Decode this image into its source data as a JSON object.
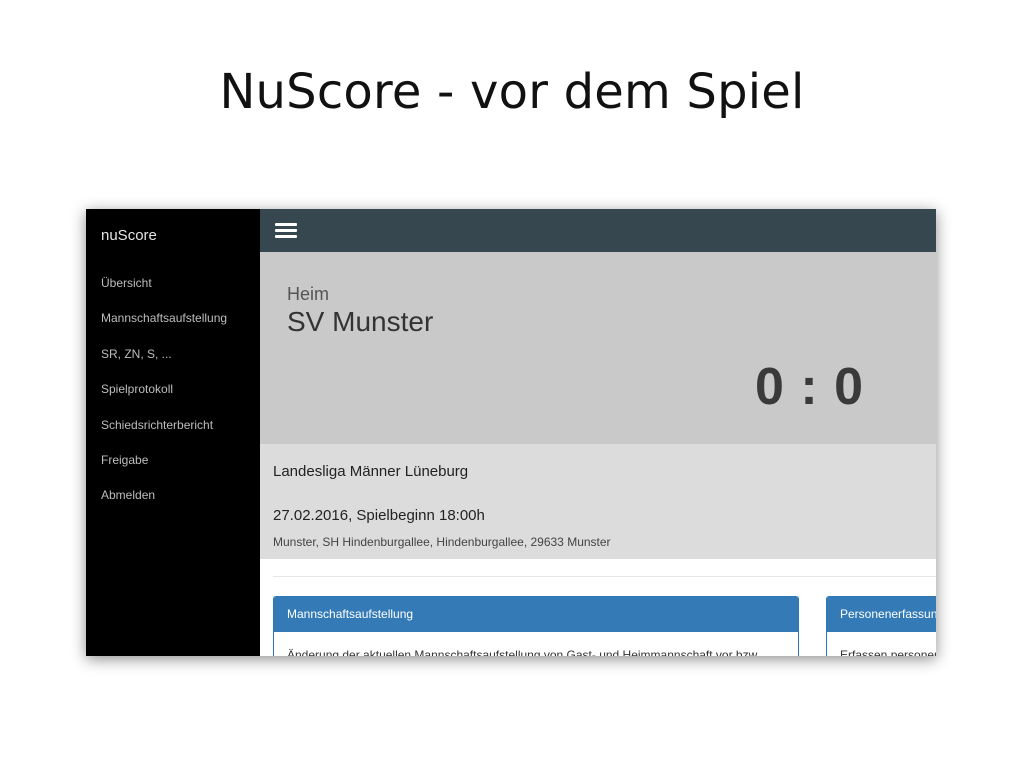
{
  "slide": {
    "title": "NuScore - vor dem Spiel"
  },
  "app": {
    "brand": "nuScore",
    "nav": [
      "Übersicht",
      "Mannschaftsaufstellung",
      "SR, ZN, S, ...",
      "Spielprotokoll",
      "Schiedsrichterbericht",
      "Freigabe",
      "Abmelden"
    ],
    "menu_icon": "hamburger-menu-icon"
  },
  "match": {
    "role": "Heim",
    "team": "SV Munster",
    "score": "0 : 0",
    "league": "Landesliga Männer Lüneburg",
    "datetime": "27.02.2016, Spielbeginn 18:00h",
    "venue": "Munster, SH Hindenburgallee, Hindenburgallee, 29633 Munster"
  },
  "cards": [
    {
      "title": "Mannschaftsaufstellung",
      "body": "Änderung der aktuellen Mannschaftsaufstellung von Gast- und Heimmannschaft vor bzw."
    },
    {
      "title": "Personenerfassung",
      "body": "Erfassen personen"
    }
  ],
  "colors": {
    "sidebar": "#000000",
    "topbar": "#37474f",
    "hero": "#c9c9c9",
    "info": "#dcdcdc",
    "card_header": "#337ab7"
  }
}
